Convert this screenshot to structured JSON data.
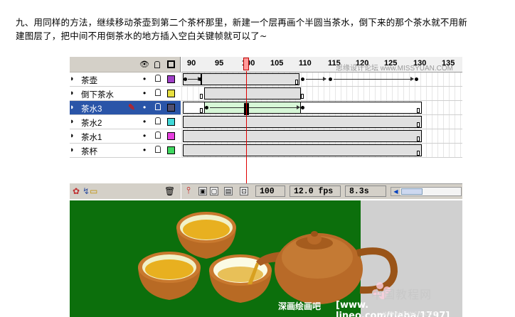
{
  "instruction": {
    "line1": "九、用同样的方法，继续移动茶壶到第二个茶杯那里，新建一个层再画个半圆当茶水，倒下来的那个茶水就不用新",
    "line2": "建图层了，把中间不用倒茶水的地方插入空白关键帧就可以了~"
  },
  "flash_timeline": {
    "header_icons": [
      "eye-icon",
      "lock-icon",
      "outline-icon"
    ],
    "layers": [
      {
        "name": "茶壶",
        "color": "#a040c8",
        "selected": false
      },
      {
        "name": "倒下茶水",
        "color": "#e8e040",
        "selected": false
      },
      {
        "name": "茶水3",
        "color": "#505070",
        "selected": true
      },
      {
        "name": "茶水2",
        "color": "#40d8d8",
        "selected": false
      },
      {
        "name": "茶水1",
        "color": "#e840e0",
        "selected": false
      },
      {
        "name": "茶杯",
        "color": "#40d860",
        "selected": false
      }
    ],
    "ruler_labels": [
      "90",
      "95",
      "100",
      "105",
      "110",
      "115",
      "120",
      "125",
      "130",
      "135"
    ],
    "current_frame": "100",
    "frame_rate": "12.0 fps",
    "elapsed_time": "8.3s",
    "top_watermark": "思缘设计论坛 www.MISSYUAN.COM",
    "footer_icons": [
      "add-layer-icon",
      "add-motion-guide-icon",
      "insert-folder-icon",
      "trash-icon"
    ],
    "timeline_icons": [
      "center-frame-icon",
      "onion-skin-icon",
      "onion-skin-outlines-icon",
      "edit-multiple-frames-icon",
      "modify-onion-markers-icon"
    ]
  },
  "stage": {
    "background_color": "#0c6f0c",
    "watermark_cn": "中国教程网",
    "watermark_site_left": "深画绘画吧",
    "watermark_site": "[www. lineo.com/tieba/1797]",
    "watermark_small": "www.jcwcn.com"
  }
}
